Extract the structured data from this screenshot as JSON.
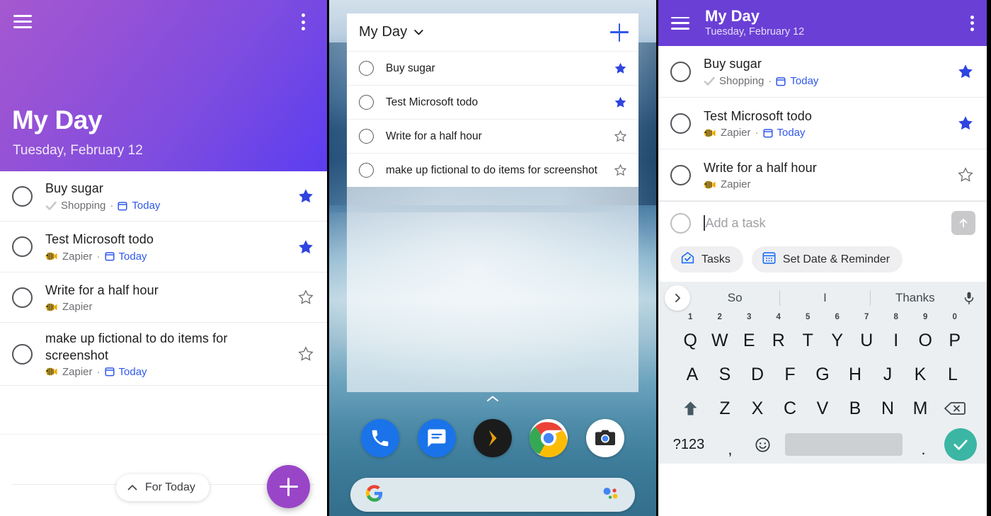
{
  "panel1": {
    "header": {
      "title": "My Day",
      "subtitle": "Tuesday, February 12",
      "menu_icon": "hamburger-menu-icon",
      "overflow_icon": "more-vertical-icon"
    },
    "tasks": [
      {
        "title": "Buy sugar",
        "list": "Shopping",
        "list_icon": "gray-check-icon",
        "separator": "·",
        "due": "Today",
        "due_icon": "calendar-icon",
        "starred": true
      },
      {
        "title": "Test Microsoft todo",
        "list": "Zapier",
        "list_icon": "fish-emoji-icon",
        "separator": "·",
        "due": "Today",
        "due_icon": "calendar-icon",
        "starred": true
      },
      {
        "title": "Write for a half hour",
        "list": "Zapier",
        "list_icon": "fish-emoji-icon",
        "separator": "",
        "due": "",
        "due_icon": "",
        "starred": false
      },
      {
        "title": "make up fictional to do items for screenshot",
        "list": "Zapier",
        "list_icon": "fish-emoji-icon",
        "separator": "·",
        "due": "Today",
        "due_icon": "calendar-icon",
        "starred": false
      }
    ],
    "for_today_label": "For Today",
    "for_today_icon": "chevron-up-icon",
    "fab_label": "add-task-fab",
    "accent_purple": "#9945c8",
    "star_blue": "#2f44e0"
  },
  "panel2": {
    "widget": {
      "title": "My Day",
      "dropdown_icon": "chevron-down-icon",
      "add_icon": "plus-icon",
      "tasks": [
        {
          "title": "Buy sugar",
          "starred": true
        },
        {
          "title": "Test Microsoft todo",
          "starred": true
        },
        {
          "title": "Write for a half hour",
          "starred": false
        },
        {
          "title": "make up fictional to do items for screenshot",
          "starred": false
        }
      ]
    },
    "page_indicator_icon": "chevron-up-icon",
    "dock": [
      {
        "name": "Phone",
        "icon": "phone-icon"
      },
      {
        "name": "Messages",
        "icon": "message-icon"
      },
      {
        "name": "Plex",
        "icon": "plex-chevron-icon"
      },
      {
        "name": "Chrome",
        "icon": "chrome-icon"
      },
      {
        "name": "Camera",
        "icon": "camera-icon"
      }
    ],
    "search": {
      "logo_icon": "google-g-icon",
      "assistant_icon": "google-assistant-icon"
    }
  },
  "panel3": {
    "header": {
      "title": "My Day",
      "subtitle": "Tuesday, February 12",
      "menu_icon": "hamburger-menu-icon",
      "overflow_icon": "more-vertical-icon",
      "bg_color": "#6a3fd6"
    },
    "tasks": [
      {
        "title": "Buy sugar",
        "list": "Shopping",
        "list_icon": "gray-check-icon",
        "separator": "·",
        "due": "Today",
        "due_icon": "calendar-icon",
        "starred": true
      },
      {
        "title": "Test Microsoft todo",
        "list": "Zapier",
        "list_icon": "fish-emoji-icon",
        "separator": "·",
        "due": "Today",
        "due_icon": "calendar-icon",
        "starred": true
      },
      {
        "title": "Write for a half hour",
        "list": "Zapier",
        "list_icon": "fish-emoji-icon",
        "separator": "",
        "due": "",
        "due_icon": "",
        "starred": false
      }
    ],
    "add_task": {
      "placeholder": "Add a task",
      "send_icon": "arrow-up-icon",
      "chips": [
        {
          "label": "Tasks",
          "icon": "home-check-icon"
        },
        {
          "label": "Set Date & Reminder",
          "icon": "calendar-reminder-icon"
        }
      ]
    },
    "keyboard": {
      "expand_icon": "chevron-right-icon",
      "mic_icon": "microphone-icon",
      "suggestions": [
        "So",
        "I",
        "Thanks"
      ],
      "row1": [
        {
          "letter": "Q",
          "num": "1"
        },
        {
          "letter": "W",
          "num": "2"
        },
        {
          "letter": "E",
          "num": "3"
        },
        {
          "letter": "R",
          "num": "4"
        },
        {
          "letter": "T",
          "num": "5"
        },
        {
          "letter": "Y",
          "num": "6"
        },
        {
          "letter": "U",
          "num": "7"
        },
        {
          "letter": "I",
          "num": "8"
        },
        {
          "letter": "O",
          "num": "9"
        },
        {
          "letter": "P",
          "num": "0"
        }
      ],
      "row2": [
        "A",
        "S",
        "D",
        "F",
        "G",
        "H",
        "J",
        "K",
        "L"
      ],
      "row3": [
        "Z",
        "X",
        "C",
        "V",
        "B",
        "N",
        "M"
      ],
      "shift_icon": "shift-up-icon",
      "backspace_icon": "backspace-icon",
      "symbols_label": "?123",
      "comma_label": ",",
      "emoji_icon": "emoji-smiley-icon",
      "period_label": ".",
      "enter_icon": "check-confirm-icon",
      "enter_color": "#3bb6a4"
    }
  }
}
